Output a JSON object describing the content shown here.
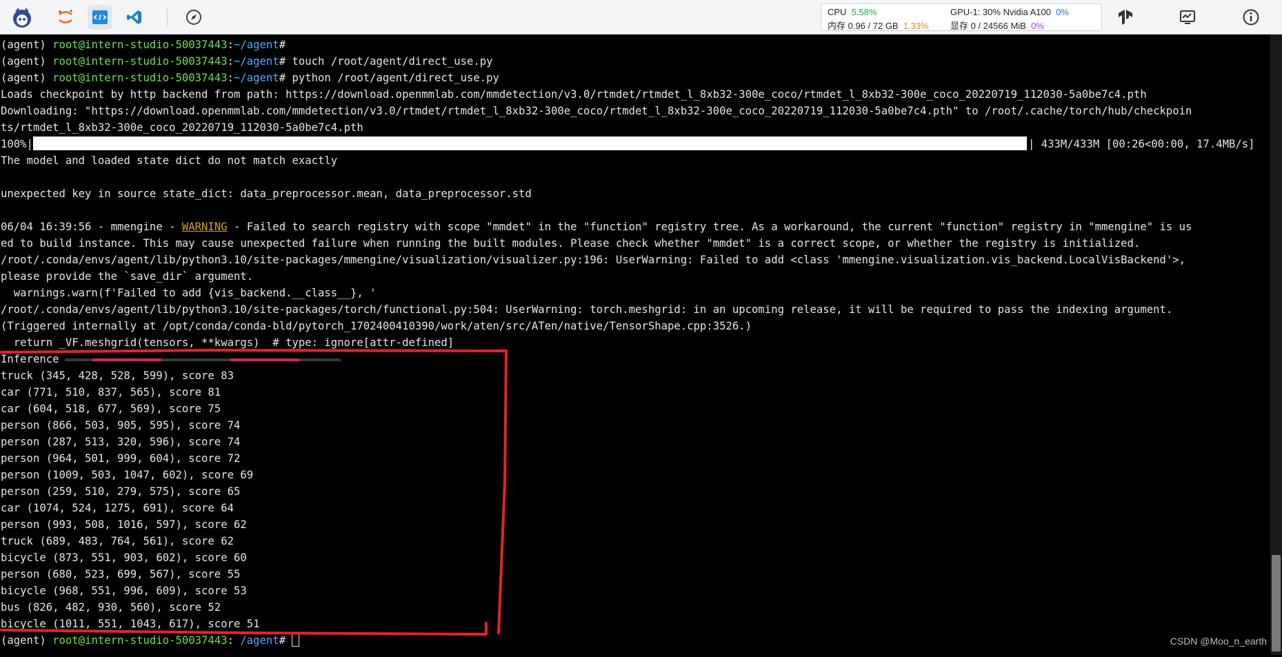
{
  "topbar": {
    "apps": [
      {
        "name": "launcher-icon"
      },
      {
        "name": "jupyter-icon"
      },
      {
        "name": "terminal-icon"
      },
      {
        "name": "vscode-icon"
      },
      {
        "name": "compass-icon"
      }
    ],
    "monitor": {
      "cpu_label": "CPU",
      "cpu_value": "5.58%",
      "mem_label": "内存 0.96 / 72 GB",
      "mem_value": "1.33%",
      "gpu_label": "GPU-1: 30% Nvidia A100",
      "gpu_value": "0%",
      "vram_label": "显存 0 / 24566 MiB",
      "vram_value": "0%"
    },
    "colors": {
      "green": "#1aa94a",
      "orange": "#e8891a",
      "blue": "#2d6be4",
      "purple": "#9a45d6"
    }
  },
  "terminal": {
    "prompt_env": "(agent) ",
    "prompt_host": "root@intern-studio-50037443",
    "prompt_path": "~/agent",
    "prompt_end": "# ",
    "cmd1": "touch /root/agent/direct_use.py",
    "cmd2": "python /root/agent/direct_use.py",
    "line_loads": "Loads checkpoint by http backend from path: https://download.openmmlab.com/mmdetection/v3.0/rtmdet/rtmdet_l_8xb32-300e_coco/rtmdet_l_8xb32-300e_coco_20220719_112030-5a0be7c4.pth",
    "line_dl1": "Downloading: \"https://download.openmmlab.com/mmdetection/v3.0/rtmdet/rtmdet_l_8xb32-300e_coco/rtmdet_l_8xb32-300e_coco_20220719_112030-5a0be7c4.pth\" to /root/.cache/torch/hub/checkpoin",
    "line_dl2": "ts/rtmdet_l_8xb32-300e_coco_20220719_112030-5a0be7c4.pth",
    "progress_label": "100%|",
    "progress_fraction": 1.0,
    "progress_tail": "| 433M/433M [00:26<00:00, 17.4MB/s]",
    "line_mismatch": "The model and loaded state dict do not match exactly",
    "line_unexpected": "unexpected key in source state_dict: data_preprocessor.mean, data_preprocessor.std",
    "warn_prefix": "06/04 16:39:56 - mmengine - ",
    "warn_word": "WARNING",
    "warn_rest": " - Failed to search registry with scope \"mmdet\" in the \"function\" registry tree. As a workaround, the current \"function\" registry in \"mmengine\" is us",
    "warn_line2": "ed to build instance. This may cause unexpected failure when running the built modules. Please check whether \"mmdet\" is a correct scope, or whether the registry is initialized.",
    "vis_line1": "/root/.conda/envs/agent/lib/python3.10/site-packages/mmengine/visualization/visualizer.py:196: UserWarning: Failed to add <class 'mmengine.visualization.vis_backend.LocalVisBackend'>,",
    "vis_line2": "please provide the `save_dir` argument.",
    "vis_line3": "  warnings.warn(f'Failed to add {vis_backend.__class__}, '",
    "torch_line1": "/root/.conda/envs/agent/lib/python3.10/site-packages/torch/functional.py:504: UserWarning: torch.meshgrid: in an upcoming release, it will be required to pass the indexing argument.",
    "torch_line2": "(Triggered internally at /opt/conda/conda-bld/pytorch_1702400410390/work/aten/src/ATen/native/TensorShape.cpp:3526.)",
    "torch_line3": "  return _VF.meshgrid(tensors, **kwargs)  # type: ignore[attr-defined]",
    "inference_label": "Inference",
    "detections": [
      "truck (345, 428, 528, 599), score 83",
      "car (771, 510, 837, 565), score 81",
      "car (604, 518, 677, 569), score 75",
      "person (866, 503, 905, 595), score 74",
      "person (287, 513, 320, 596), score 74",
      "person (964, 501, 999, 604), score 72",
      "person (1009, 503, 1047, 602), score 69",
      "person (259, 510, 279, 575), score 65",
      "car (1074, 524, 1275, 691), score 64",
      "person (993, 508, 1016, 597), score 62",
      "truck (689, 483, 764, 561), score 62",
      "bicycle (873, 551, 903, 602), score 60",
      "person (680, 523, 699, 567), score 55",
      "bicycle (968, 551, 996, 609), score 53",
      "bus (826, 482, 930, 560), score 52",
      "bicycle (1011, 551, 1043, 617), score 51"
    ],
    "final_path": " /agent"
  },
  "watermark": "CSDN @Moo_n_earth"
}
